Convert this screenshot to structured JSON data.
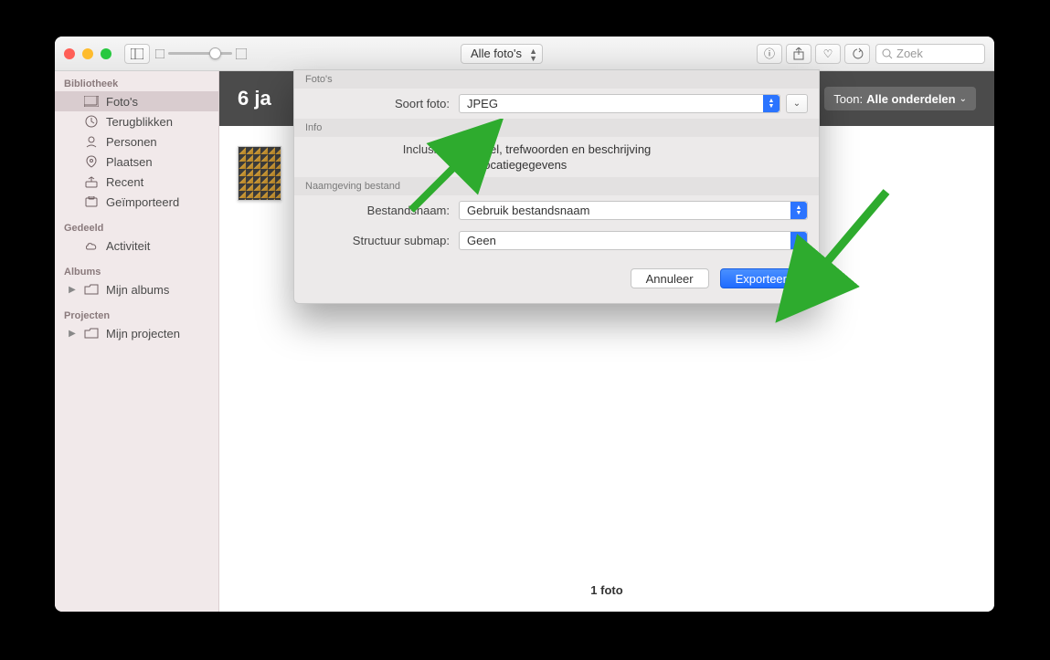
{
  "toolbar": {
    "title_dropdown": "Alle foto's",
    "search_placeholder": "Zoek"
  },
  "sidebar": {
    "sections": [
      {
        "header": "Bibliotheek",
        "items": [
          {
            "label": "Foto's",
            "selected": true
          },
          {
            "label": "Terugblikken"
          },
          {
            "label": "Personen"
          },
          {
            "label": "Plaatsen"
          },
          {
            "label": "Recent"
          },
          {
            "label": "Geïmporteerd"
          }
        ]
      },
      {
        "header": "Gedeeld",
        "items": [
          {
            "label": "Activiteit"
          }
        ]
      },
      {
        "header": "Albums",
        "items": [
          {
            "label": "Mijn albums",
            "disclosure": true
          }
        ]
      },
      {
        "header": "Projecten",
        "items": [
          {
            "label": "Mijn projecten",
            "disclosure": true
          }
        ]
      }
    ]
  },
  "main": {
    "header_title": "6 ja",
    "show_button_prefix": "Toon:",
    "show_button_value": "Alle onderdelen",
    "footer": "1 foto"
  },
  "dialog": {
    "section_photos": "Foto's",
    "photo_kind_label": "Soort foto:",
    "photo_kind_value": "JPEG",
    "section_info": "Info",
    "inclusive_label": "Inclusief:",
    "checkbox_title": "Titel, trefwoorden en beschrijving",
    "checkbox_location": "Locatiegegevens",
    "checkbox_title_checked": true,
    "checkbox_location_checked": false,
    "section_naming": "Naamgeving bestand",
    "filename_label": "Bestandsnaam:",
    "filename_value": "Gebruik bestandsnaam",
    "subfolder_label": "Structuur submap:",
    "subfolder_value": "Geen",
    "cancel": "Annuleer",
    "export": "Exporteer"
  }
}
